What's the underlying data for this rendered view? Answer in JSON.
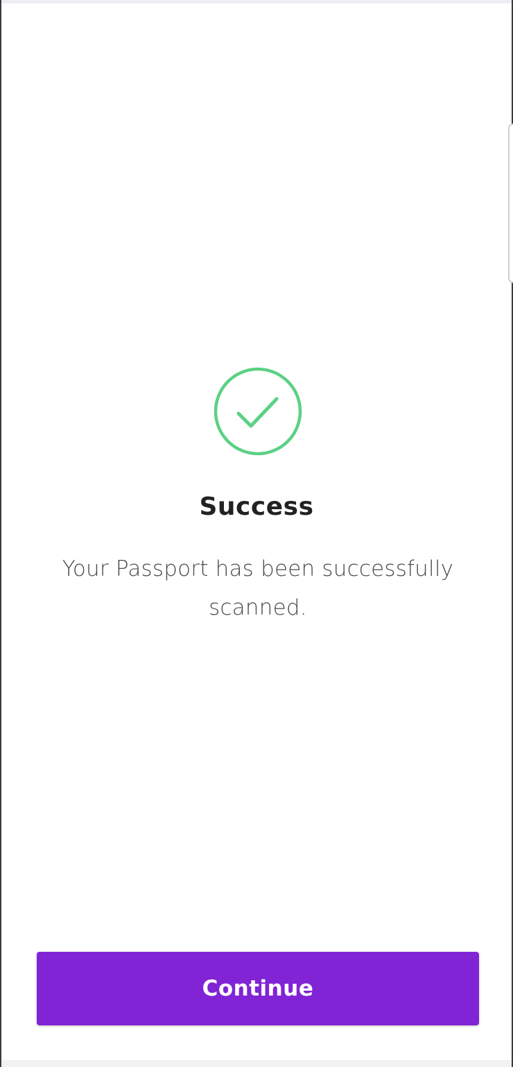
{
  "screen": {
    "title": "Success",
    "message": "Your Passport has been successfully scanned.",
    "icon": "check-circle-icon"
  },
  "actions": {
    "continue_label": "Continue"
  },
  "colors": {
    "success": "#5bd184",
    "accent": "#8024d6",
    "title_text": "#222222",
    "body_text": "#4a4a4a"
  }
}
